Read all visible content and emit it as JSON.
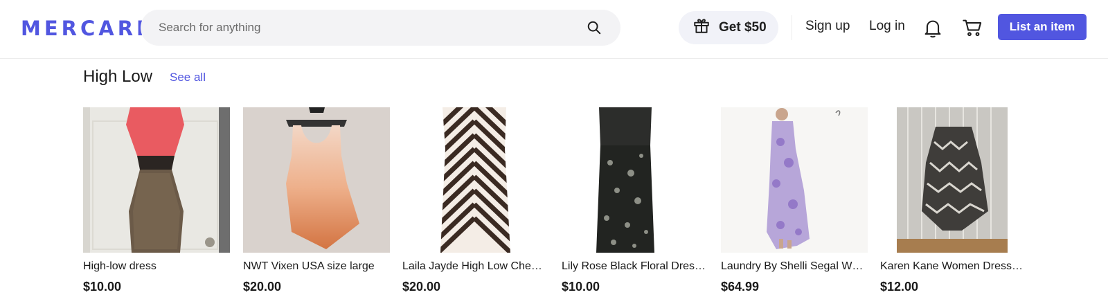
{
  "header": {
    "logo": "MERCARI",
    "search_placeholder": "Search for anything",
    "promo_label": "Get $50",
    "signup_label": "Sign up",
    "login_label": "Log in",
    "list_button_label": "List an item",
    "brand_color": "#5156e0"
  },
  "section": {
    "title": "High Low",
    "see_all_label": "See all",
    "items": [
      {
        "title": "High-low dress",
        "price": "$10.00"
      },
      {
        "title": "NWT Vixen USA size large",
        "price": "$20.00"
      },
      {
        "title": "Laila Jayde High Low Che…",
        "price": "$20.00"
      },
      {
        "title": "Lily Rose Black Floral Dres…",
        "price": "$10.00"
      },
      {
        "title": "Laundry By Shelli Segal W…",
        "price": "$64.99"
      },
      {
        "title": "Karen Kane Women Dress…",
        "price": "$12.00"
      }
    ]
  }
}
